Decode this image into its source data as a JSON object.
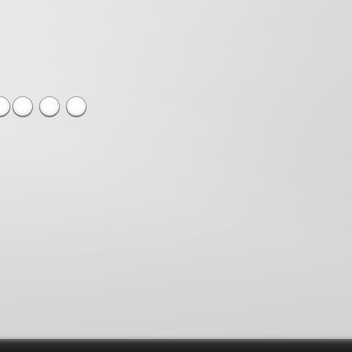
{
  "scene": {
    "subject": "perforated-panel",
    "surface_color": "#dcdcdc",
    "hole_rim_color": "#5f5f5f",
    "edge_color": "#1d1d1d"
  },
  "holes": {
    "visible_count": 4
  }
}
